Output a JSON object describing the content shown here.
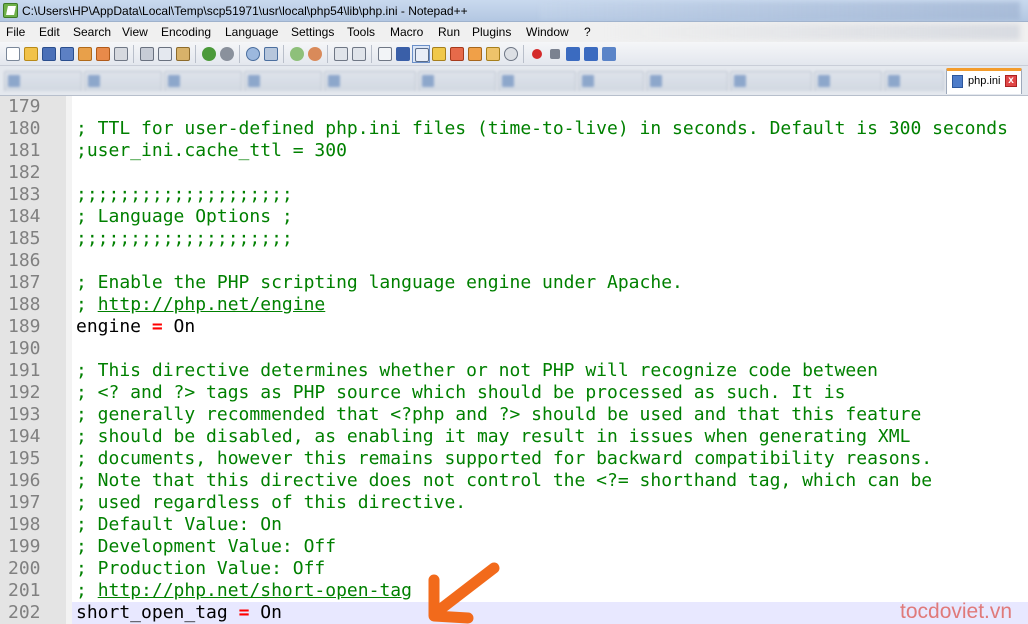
{
  "window": {
    "title": "C:\\Users\\HP\\AppData\\Local\\Temp\\scp51971\\usr\\local\\php54\\lib\\php.ini - Notepad++"
  },
  "menu": [
    "File",
    "Edit",
    "Search",
    "View",
    "Encoding",
    "Language",
    "Settings",
    "Tools",
    "Macro",
    "Run",
    "Plugins",
    "Window",
    "?"
  ],
  "tabs": {
    "active_label": "php.ini",
    "close_glyph": "x"
  },
  "editor": {
    "lines": [
      {
        "num": "179",
        "segments": []
      },
      {
        "num": "180",
        "segments": [
          {
            "t": "; TTL for user-defined php.ini files (time-to-live) in seconds. Default is 300 seconds",
            "c": "c"
          }
        ]
      },
      {
        "num": "181",
        "segments": [
          {
            "t": ";user_ini.cache_ttl = 300",
            "c": "c"
          }
        ]
      },
      {
        "num": "182",
        "segments": []
      },
      {
        "num": "183",
        "segments": [
          {
            "t": ";;;;;;;;;;;;;;;;;;;;",
            "c": "c"
          }
        ]
      },
      {
        "num": "184",
        "segments": [
          {
            "t": "; Language Options ;",
            "c": "c"
          }
        ]
      },
      {
        "num": "185",
        "segments": [
          {
            "t": ";;;;;;;;;;;;;;;;;;;;",
            "c": "c"
          }
        ]
      },
      {
        "num": "186",
        "segments": []
      },
      {
        "num": "187",
        "segments": [
          {
            "t": "; Enable the PHP scripting language engine under Apache.",
            "c": "c"
          }
        ]
      },
      {
        "num": "188",
        "segments": [
          {
            "t": "; ",
            "c": "c"
          },
          {
            "t": "http://php.net/engine",
            "c": "u"
          }
        ]
      },
      {
        "num": "189",
        "segments": [
          {
            "t": "engine ",
            "c": "k"
          },
          {
            "t": "=",
            "c": "op"
          },
          {
            "t": " On",
            "c": "k"
          }
        ]
      },
      {
        "num": "190",
        "segments": []
      },
      {
        "num": "191",
        "segments": [
          {
            "t": "; This directive determines whether or not PHP will recognize code between",
            "c": "c"
          }
        ]
      },
      {
        "num": "192",
        "segments": [
          {
            "t": "; <? and ?> tags as PHP source which should be processed as such. It is",
            "c": "c"
          }
        ]
      },
      {
        "num": "193",
        "segments": [
          {
            "t": "; generally recommended that <?php and ?> should be used and that this feature",
            "c": "c"
          }
        ]
      },
      {
        "num": "194",
        "segments": [
          {
            "t": "; should be disabled, as enabling it may result in issues when generating XML",
            "c": "c"
          }
        ]
      },
      {
        "num": "195",
        "segments": [
          {
            "t": "; documents, however this remains supported for backward compatibility reasons.",
            "c": "c"
          }
        ]
      },
      {
        "num": "196",
        "segments": [
          {
            "t": "; Note that this directive does not control the <?= shorthand tag, which can be",
            "c": "c"
          }
        ]
      },
      {
        "num": "197",
        "segments": [
          {
            "t": "; used regardless of this directive.",
            "c": "c"
          }
        ]
      },
      {
        "num": "198",
        "segments": [
          {
            "t": "; Default Value: On",
            "c": "c"
          }
        ]
      },
      {
        "num": "199",
        "segments": [
          {
            "t": "; Development Value: Off",
            "c": "c"
          }
        ]
      },
      {
        "num": "200",
        "segments": [
          {
            "t": "; Production Value: Off",
            "c": "c"
          }
        ]
      },
      {
        "num": "201",
        "segments": [
          {
            "t": "; ",
            "c": "c"
          },
          {
            "t": "http://php.net/short-open-tag",
            "c": "u"
          }
        ]
      },
      {
        "num": "202",
        "segments": [
          {
            "t": "short_open_tag ",
            "c": "k"
          },
          {
            "t": "=",
            "c": "op"
          },
          {
            "t": " On",
            "c": "k"
          }
        ],
        "current": true
      }
    ]
  },
  "watermark": "tocdoviet.vn",
  "colors": {
    "comment": "#008000",
    "operator": "#ff0000",
    "arrow": "#f26a1b",
    "current_line": "#e8e8ff"
  }
}
